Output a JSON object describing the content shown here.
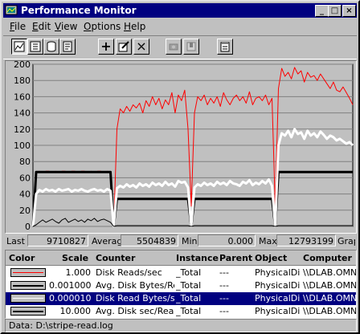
{
  "window": {
    "title": "Performance Monitor",
    "buttons": [
      "_",
      "□",
      "×"
    ]
  },
  "menu": [
    {
      "pre": "",
      "u": "F",
      "post": "ile"
    },
    {
      "pre": "",
      "u": "E",
      "post": "dit"
    },
    {
      "pre": "",
      "u": "V",
      "post": "iew"
    },
    {
      "pre": "",
      "u": "O",
      "post": "ptions"
    },
    {
      "pre": "",
      "u": "H",
      "post": "elp"
    }
  ],
  "toolbar": {
    "icons": [
      "chart-view-icon",
      "alert-view-icon",
      "log-view-icon",
      "report-view-icon",
      "add-counter-icon",
      "edit-counter-icon",
      "delete-counter-icon",
      "update-now-icon",
      "bookmark-icon",
      "options-icon"
    ],
    "add": "+",
    "delete": "×"
  },
  "stats": {
    "last_label": "Last",
    "last_value": "9710827",
    "average_label": "Average",
    "average_value": "5504839",
    "min_label": "Min",
    "min_value": "0.000",
    "max_label": "Max",
    "max_value": "12793199",
    "graph_label": "Graph"
  },
  "legend": {
    "headers": [
      "Color",
      "Scale",
      "Counter",
      "Instance",
      "Parent",
      "Object",
      "Computer"
    ],
    "rows": [
      {
        "color": "#ff0000",
        "scale": "1.000",
        "counter": "Disk Reads/sec",
        "instance": "_Total",
        "parent": "---",
        "object": "PhysicalDisk",
        "computer": "\\\\DLAB.OMN",
        "selected": false
      },
      {
        "color": "#000000",
        "scale": "0.0010000",
        "counter": "Avg. Disk Bytes/Read",
        "instance": "_Total",
        "parent": "---",
        "object": "PhysicalDisk",
        "computer": "\\\\DLAB.OMN",
        "selected": false
      },
      {
        "color": "#ffffff",
        "scale": "0.0000100",
        "counter": "Disk Read Bytes/sec",
        "instance": "_Total",
        "parent": "---",
        "object": "PhysicalDisk",
        "computer": "\\\\DLAB.OMN",
        "selected": true
      },
      {
        "color": "#000000",
        "scale": "10.000",
        "counter": "Avg. Disk sec/Read",
        "instance": "_Total",
        "parent": "---",
        "object": "PhysicalDisk",
        "computer": "\\\\DLAB.OMN",
        "selected": false
      }
    ]
  },
  "status": {
    "text": "Data: D:\\stripe-read.log"
  },
  "chart_data": {
    "type": "line",
    "yticks": [
      "0",
      "20",
      "40",
      "60",
      "80",
      "100",
      "120",
      "140",
      "160",
      "180",
      "200"
    ],
    "ylim": [
      0,
      200
    ],
    "grid": true,
    "n": 100,
    "series": [
      {
        "name": "Disk Reads/sec",
        "color": "#ff0000",
        "width": 1,
        "values": [
          0,
          66,
          68,
          67,
          68,
          68,
          67,
          68,
          67,
          68,
          68,
          67,
          68,
          68,
          67,
          68,
          68,
          67,
          68,
          67,
          68,
          68,
          67,
          68,
          66,
          0,
          120,
          145,
          140,
          148,
          142,
          150,
          146,
          152,
          140,
          155,
          148,
          160,
          150,
          158,
          145,
          156,
          150,
          165,
          140,
          162,
          155,
          168,
          120,
          25,
          140,
          160,
          155,
          162,
          150,
          158,
          152,
          160,
          148,
          165,
          156,
          150,
          158,
          162,
          155,
          160,
          152,
          166,
          150,
          158,
          160,
          155,
          162,
          150,
          158,
          25,
          170,
          195,
          185,
          190,
          182,
          196,
          188,
          192,
          178,
          190,
          184,
          186,
          180,
          188,
          182,
          176,
          170,
          178,
          168,
          166,
          172,
          165,
          158,
          150
        ]
      },
      {
        "name": "Avg. Disk Bytes/Read",
        "color": "#000000",
        "width": 3,
        "values": [
          0,
          67,
          67,
          67,
          67,
          67,
          67,
          67,
          67,
          67,
          67,
          67,
          67,
          67,
          67,
          67,
          67,
          67,
          67,
          67,
          67,
          67,
          67,
          67,
          67,
          0,
          34,
          34,
          34,
          34,
          34,
          34,
          34,
          34,
          34,
          34,
          34,
          34,
          34,
          34,
          34,
          34,
          34,
          34,
          34,
          34,
          34,
          34,
          34,
          0,
          34,
          34,
          34,
          34,
          34,
          34,
          34,
          34,
          34,
          34,
          34,
          34,
          34,
          34,
          34,
          34,
          34,
          34,
          34,
          34,
          34,
          34,
          34,
          34,
          34,
          0,
          67,
          67,
          67,
          67,
          67,
          67,
          67,
          67,
          67,
          67,
          67,
          67,
          67,
          67,
          67,
          67,
          67,
          67,
          67,
          67,
          67,
          67,
          67,
          67
        ]
      },
      {
        "name": "Disk Read Bytes/sec",
        "color": "#ffffff",
        "width": 3,
        "values": [
          0,
          40,
          45,
          43,
          46,
          44,
          45,
          43,
          46,
          44,
          45,
          46,
          43,
          45,
          44,
          46,
          44,
          43,
          45,
          46,
          44,
          45,
          43,
          46,
          44,
          0,
          47,
          50,
          48,
          52,
          49,
          51,
          48,
          53,
          50,
          52,
          49,
          54,
          51,
          53,
          50,
          55,
          51,
          53,
          49,
          56,
          54,
          55,
          48,
          0,
          48,
          52,
          50,
          54,
          51,
          53,
          50,
          55,
          52,
          54,
          51,
          56,
          53,
          52,
          50,
          55,
          53,
          57,
          51,
          54,
          52,
          56,
          53,
          58,
          50,
          0,
          100,
          115,
          112,
          118,
          110,
          120,
          114,
          116,
          108,
          118,
          112,
          115,
          110,
          117,
          113,
          108,
          112,
          110,
          106,
          108,
          105,
          102,
          104,
          100
        ]
      },
      {
        "name": "Avg. Disk sec/Read",
        "color": "#000000",
        "width": 1,
        "values": [
          0,
          2,
          5,
          8,
          5,
          7,
          9,
          6,
          4,
          8,
          10,
          5,
          7,
          9,
          6,
          8,
          5,
          9,
          7,
          10,
          6,
          8,
          9,
          7,
          5,
          0,
          1,
          1,
          1,
          1,
          1,
          1,
          1,
          1,
          1,
          1,
          1,
          1,
          1,
          1,
          1,
          1,
          1,
          1,
          1,
          1,
          1,
          1,
          1,
          0,
          1,
          1,
          1,
          1,
          1,
          1,
          1,
          1,
          1,
          1,
          1,
          1,
          1,
          1,
          1,
          1,
          1,
          1,
          1,
          1,
          1,
          1,
          1,
          1,
          1,
          0,
          1,
          1,
          1,
          1,
          1,
          1,
          1,
          1,
          1,
          1,
          1,
          1,
          1,
          1,
          1,
          1,
          1,
          1,
          1,
          1,
          1,
          1,
          1,
          1
        ]
      }
    ]
  }
}
